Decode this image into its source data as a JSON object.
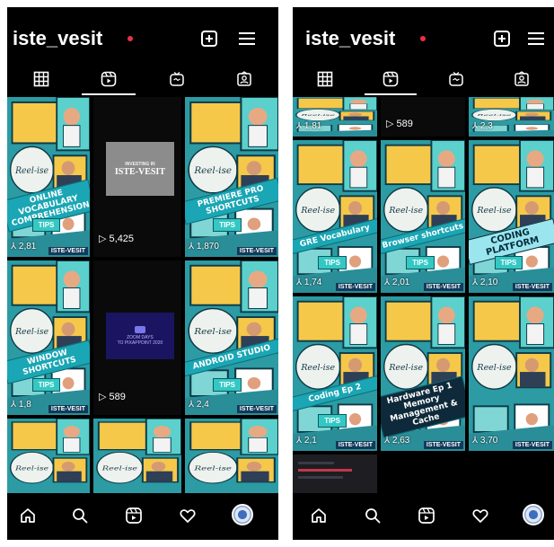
{
  "profile": {
    "username": "iste_vesit"
  },
  "icons": {
    "new_post": "plus-square-icon",
    "menu": "hamburger-menu-icon",
    "tabs": [
      "grid-icon",
      "reels-icon",
      "igtv-icon",
      "tagged-icon"
    ],
    "nav": [
      "home-icon",
      "search-icon",
      "reels-icon",
      "heart-icon",
      "avatar"
    ]
  },
  "colors": {
    "background": "#000000",
    "accent_dot": "#e8324a",
    "reel_teal": "#2f9ea6"
  },
  "left_screen": {
    "active_tab": 1,
    "reels": [
      {
        "caption": "ONLINE VOCABULARY COMPREHENSION",
        "views": "2,81"
      },
      {
        "title_small": "INVESTING IN",
        "title_big": "ISTE-VESIT",
        "views": "5,425"
      },
      {
        "caption": "PREMIERE PRO SHORTCUTS",
        "views": "1,870"
      },
      {
        "caption": "WINDOW SHORTCUTS",
        "views": "1,8"
      },
      {
        "title_small": "ZOOM DAYS",
        "sub": "TO PIXAPPOINT 2020",
        "views": "589"
      },
      {
        "caption": "ANDROID STUDIO",
        "views": "2,4"
      },
      {
        "caption": "",
        "views": ""
      },
      {
        "caption": "",
        "views": ""
      },
      {
        "caption": "",
        "views": ""
      }
    ],
    "tips_label": "TIPS",
    "watermark": "ISTE-VESIT"
  },
  "right_screen": {
    "active_tab": 1,
    "top_row": [
      {
        "views": "1,81"
      },
      {
        "views": "589"
      },
      {
        "views": "2,3"
      }
    ],
    "reels": [
      {
        "caption": "GRE Vocabulary",
        "views": "1,74"
      },
      {
        "caption": "Browser shortcuts",
        "views": "2,01"
      },
      {
        "caption": "CODING PLATFORM",
        "views": "2,10"
      },
      {
        "caption": "Coding Ep 2",
        "views": "2,1"
      },
      {
        "caption": "Hardware Ep 1 Memory Management & Cache",
        "views": "2,63"
      },
      {
        "caption": "",
        "views": "3,70"
      }
    ],
    "tips_label": "TIPS",
    "watermark": "ISTE-VESIT"
  }
}
